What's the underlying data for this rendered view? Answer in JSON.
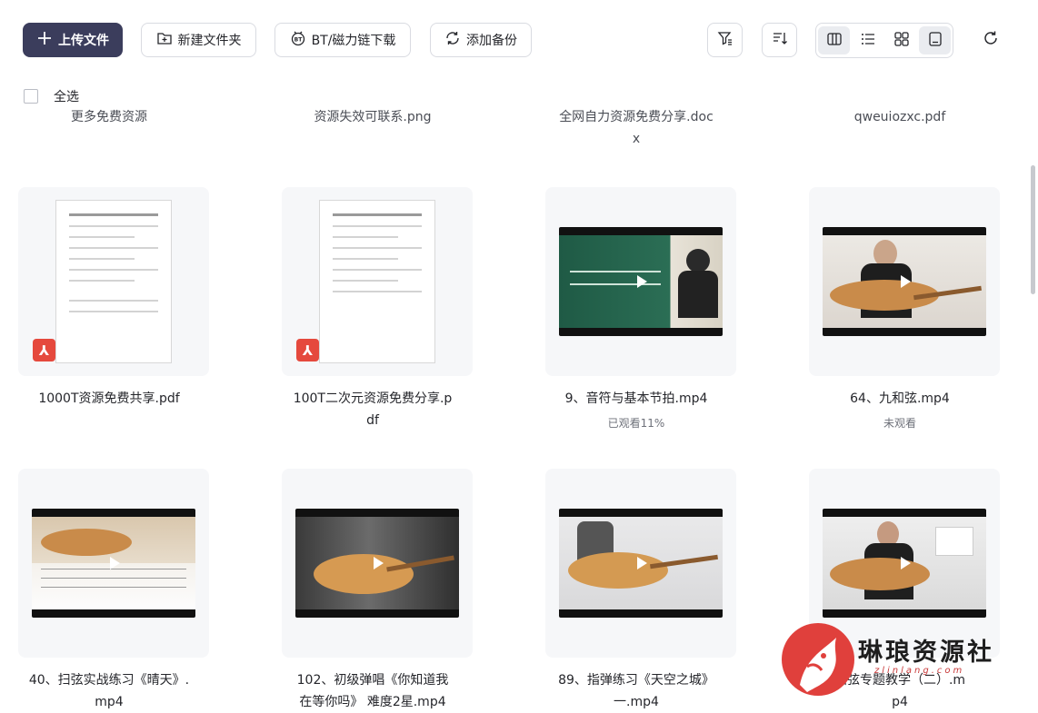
{
  "toolbar": {
    "upload_label": "上传文件",
    "new_folder_label": "新建文件夹",
    "bt_label": "BT/磁力链下载",
    "backup_label": "添加备份"
  },
  "select_all_label": "全选",
  "top_row": [
    {
      "name": "更多免费资源"
    },
    {
      "name": "资源失效可联系.png"
    },
    {
      "name": "全网自力资源免费分享.doc\nx"
    },
    {
      "name": "qweuiozxc.pdf"
    }
  ],
  "row1": [
    {
      "name": "1000T资源免费共享.pdf",
      "type": "pdf",
      "sub": ""
    },
    {
      "name": "100T二次元资源免费分享.p\ndf",
      "type": "pdf",
      "sub": ""
    },
    {
      "name": "9、音符与基本节拍.mp4",
      "type": "video",
      "sub": "已观看11%"
    },
    {
      "name": "64、九和弦.mp4",
      "type": "video",
      "sub": "未观看"
    }
  ],
  "row2": [
    {
      "name": "40、扫弦实战练习《晴天》.\nmp4",
      "type": "video"
    },
    {
      "name": "102、初级弹唱《你知道我\n在等你吗》 难度2星.mp4",
      "type": "video"
    },
    {
      "name": "89、指弹练习《天空之城》\n一.mp4",
      "type": "video"
    },
    {
      "name": "扫弦专题教学（二）.m\np4",
      "type": "video"
    }
  ],
  "watermark": {
    "title": "琳琅资源社",
    "url": "zlinlang.com"
  },
  "icons": {
    "upload": "plus-icon",
    "new_folder": "folder-plus-icon",
    "bt": "bt-icon",
    "backup": "sync-icon",
    "filter": "filter-icon",
    "sort": "sort-icon",
    "refresh": "refresh-icon"
  },
  "colors": {
    "primary_button": "#3b3d5c",
    "pdf_badge": "#e5493d",
    "card_bg": "#f6f7f9"
  }
}
